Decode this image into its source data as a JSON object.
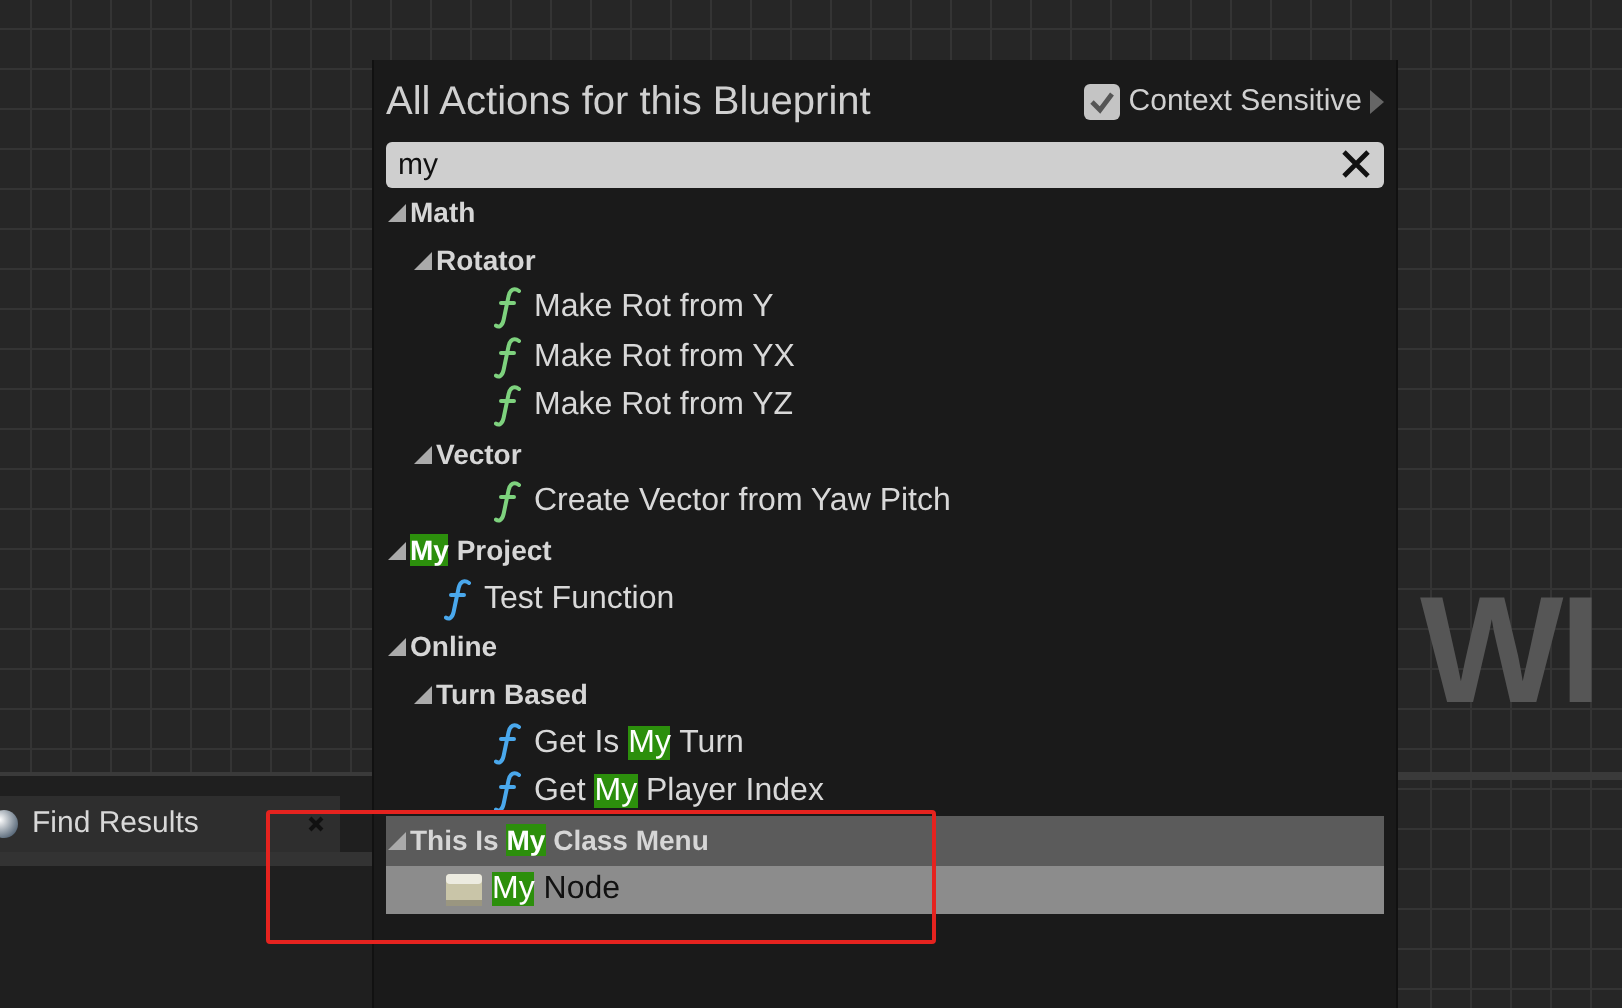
{
  "canvas": {
    "watermark": "WI"
  },
  "find_results_tab": {
    "label": "Find Results"
  },
  "action_menu": {
    "title": "All Actions for this Blueprint",
    "context_sensitive": {
      "label": "Context Sensitive",
      "checked": true
    },
    "search": {
      "value": "my"
    },
    "tree": [
      {
        "kind": "category",
        "parts": [
          {
            "text": "Math",
            "match": false
          }
        ],
        "expanded": true,
        "selected": false,
        "children": [
          {
            "kind": "category",
            "parts": [
              {
                "text": "Rotator",
                "match": false
              }
            ],
            "expanded": true,
            "selected": false,
            "children": [
              {
                "kind": "function",
                "color": "#7ed27e",
                "parts": [
                  {
                    "text": "Make Rot from Y",
                    "match": false
                  }
                ],
                "selected": false
              },
              {
                "kind": "function",
                "color": "#7ed27e",
                "parts": [
                  {
                    "text": "Make Rot from YX",
                    "match": false
                  }
                ],
                "selected": false
              },
              {
                "kind": "function",
                "color": "#7ed27e",
                "parts": [
                  {
                    "text": "Make Rot from YZ",
                    "match": false
                  }
                ],
                "selected": false
              }
            ]
          },
          {
            "kind": "category",
            "parts": [
              {
                "text": "Vector",
                "match": false
              }
            ],
            "expanded": true,
            "selected": false,
            "children": [
              {
                "kind": "function",
                "color": "#7ed27e",
                "parts": [
                  {
                    "text": "Create Vector from Yaw Pitch",
                    "match": false
                  }
                ],
                "selected": false
              }
            ]
          }
        ]
      },
      {
        "kind": "category",
        "parts": [
          {
            "text": "My",
            "match": true
          },
          {
            "text": " Project",
            "match": false
          }
        ],
        "expanded": true,
        "selected": false,
        "children": [
          {
            "kind": "function",
            "color": "#4aa8ec",
            "parts": [
              {
                "text": "Test Function",
                "match": false
              }
            ],
            "selected": false
          }
        ]
      },
      {
        "kind": "category",
        "parts": [
          {
            "text": "Online",
            "match": false
          }
        ],
        "expanded": true,
        "selected": false,
        "children": [
          {
            "kind": "category",
            "parts": [
              {
                "text": "Turn Based",
                "match": false
              }
            ],
            "expanded": true,
            "selected": false,
            "children": [
              {
                "kind": "function",
                "color": "#4aa8ec",
                "parts": [
                  {
                    "text": "Get Is ",
                    "match": false
                  },
                  {
                    "text": "My",
                    "match": true
                  },
                  {
                    "text": " Turn",
                    "match": false
                  }
                ],
                "selected": false
              },
              {
                "kind": "function",
                "color": "#4aa8ec",
                "parts": [
                  {
                    "text": "Get ",
                    "match": false
                  },
                  {
                    "text": "My",
                    "match": true
                  },
                  {
                    "text": " Player Index",
                    "match": false
                  }
                ],
                "selected": false
              }
            ]
          }
        ]
      },
      {
        "kind": "category",
        "parts": [
          {
            "text": "This Is ",
            "match": false
          },
          {
            "text": "My",
            "match": true
          },
          {
            "text": " Class Menu",
            "match": false
          }
        ],
        "expanded": true,
        "selected": true,
        "children": [
          {
            "kind": "node",
            "parts": [
              {
                "text": "My",
                "match": true
              },
              {
                "text": " Node",
                "match": false
              }
            ],
            "selected": true
          }
        ]
      }
    ]
  }
}
